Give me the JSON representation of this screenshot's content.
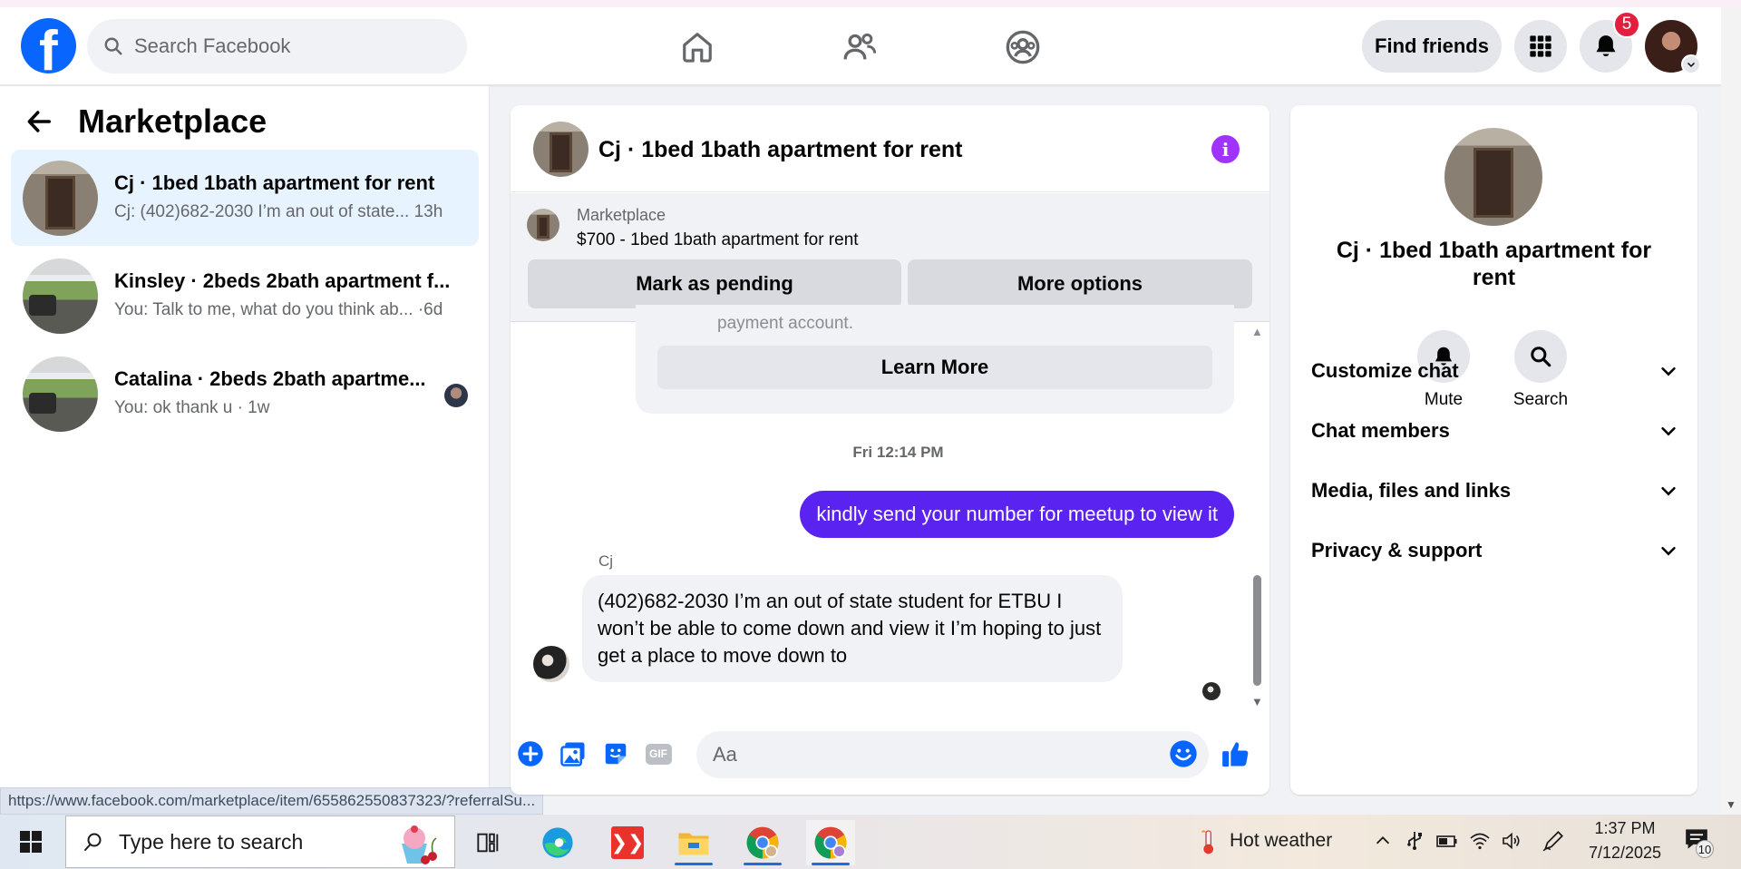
{
  "topnav": {
    "logo_letter": "f",
    "search_placeholder": "Search Facebook",
    "find_friends": "Find friends",
    "notification_count": "5"
  },
  "left": {
    "title": "Marketplace",
    "conversations": [
      {
        "title": "Cj · 1bed 1bath apartment for rent",
        "preview": "Cj: (402)682-2030 I’m an out of state...  13h"
      },
      {
        "title": "Kinsley · 2beds 2bath apartment f...",
        "preview": "You: Talk to me, what do you think ab... ·6d"
      },
      {
        "title": "Catalina · 2beds 2bath apartme...",
        "preview": "You: ok thank u · 1w"
      }
    ]
  },
  "status_url": "https://www.facebook.com/marketplace/item/655862550837323/?referralSu...",
  "chat": {
    "title": "Cj · 1bed 1bath apartment for rent",
    "marketplace_label": "Marketplace",
    "listing": "$700 - 1bed 1bath apartment for rent",
    "mark_pending": "Mark as pending",
    "more_options": "More options",
    "faded_text": "payment account.",
    "learn_more": "Learn More",
    "timestamp": "Fri 12:14 PM",
    "outgoing": "kindly send your number for meetup to view it",
    "sender": "Cj",
    "incoming": "(402)682-2030 I’m an out of state student for ETBU I won’t be able to come down and view it I’m hoping to just get a place to move down to",
    "composer_placeholder": "Aa",
    "gif_label": "GIF"
  },
  "right": {
    "name": "Cj · 1bed 1bath apartment for rent",
    "mute": "Mute",
    "search": "Search",
    "sections": [
      "Customize chat",
      "Chat members",
      "Media, files and links",
      "Privacy & support"
    ]
  },
  "taskbar": {
    "search_placeholder": "Type here to search",
    "weather": "Hot weather",
    "time": "1:37 PM",
    "date": "7/12/2025",
    "notif_count": "10"
  },
  "colors": {
    "fb_blue": "#0866ff",
    "messenger_purple": "#5b23f0",
    "info_purple": "#a033ff",
    "notif_red": "#e41e3f"
  }
}
